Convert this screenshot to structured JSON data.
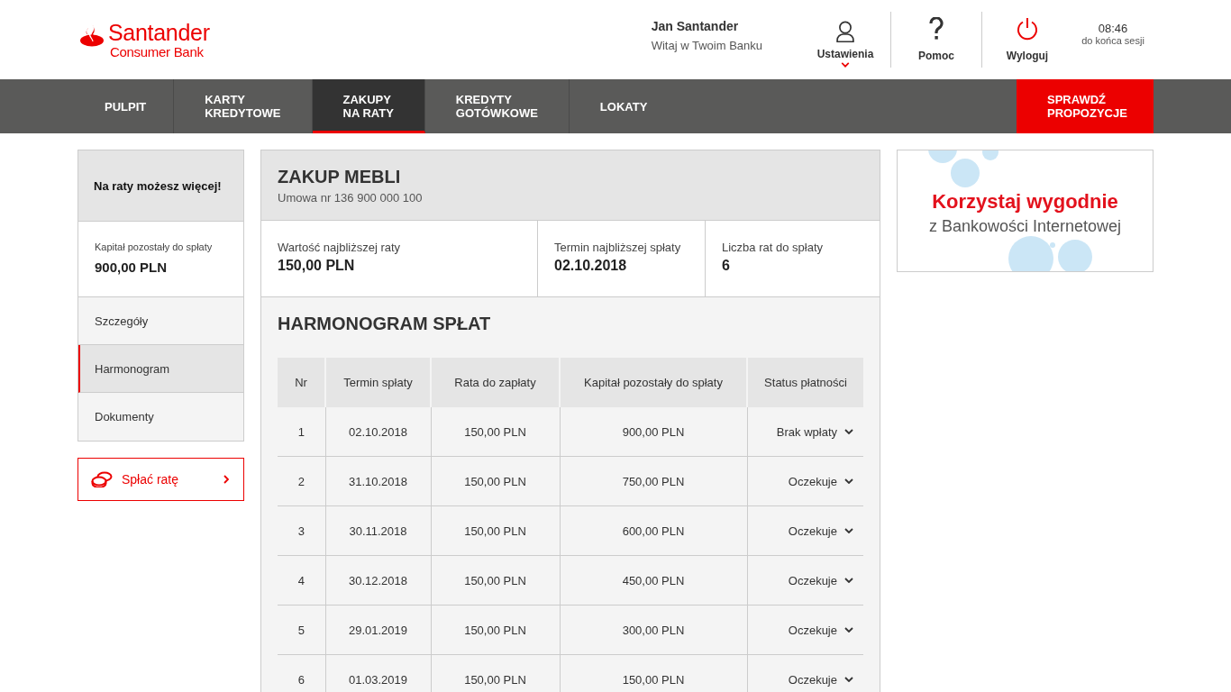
{
  "logo": {
    "brand": "Santander",
    "subtitle": "Consumer Bank"
  },
  "user": {
    "name": "Jan Santander",
    "greeting": "Witaj w Twoim Banku"
  },
  "header_actions": [
    {
      "kind": "user",
      "label": "Ustawienia",
      "expanded": false
    },
    {
      "kind": "help",
      "label": "Pomoc"
    },
    {
      "kind": "power",
      "label": "Wyloguj"
    }
  ],
  "session": {
    "time": "08:46",
    "label": "do końca sesji"
  },
  "nav": {
    "items": [
      {
        "label": "PULPIT",
        "selected": false
      },
      {
        "label": "KARTY\nKREDYTOWE",
        "selected": false
      },
      {
        "label": "ZAKUPY\nNA RATY",
        "selected": true
      },
      {
        "label": "KREDYTY\nGOTÓWKOWE",
        "selected": false
      },
      {
        "label": "LOKATY",
        "selected": false
      }
    ],
    "cta": "SPRAWDŹ\nPROPOZYCJE"
  },
  "sidebar": {
    "title": "Na raty możesz więcej!",
    "capital_label": "Kapitał pozostały do spłaty",
    "capital_value": "900,00 PLN",
    "items": [
      {
        "label": "Szczegóły",
        "selected": false
      },
      {
        "label": "Harmonogram",
        "selected": true
      },
      {
        "label": "Dokumenty",
        "selected": false
      }
    ],
    "pay_button": "Spłać ratę"
  },
  "contract": {
    "title": "ZAKUP MEBLI",
    "number": "Umowa nr 136 900 000 100",
    "stats": [
      {
        "label": "Wartość najbliższej raty",
        "value": "150,00 PLN"
      },
      {
        "label": "Termin najbliższej spłaty",
        "value": "02.10.2018"
      },
      {
        "label": "Liczba rat do spłaty",
        "value": "6"
      }
    ]
  },
  "schedule": {
    "title": "HARMONOGRAM SPŁAT",
    "columns": [
      "Nr",
      "Termin spłaty",
      "Rata do zapłaty",
      "Kapitał pozostały do spłaty",
      "Status płatności"
    ],
    "rows": [
      {
        "nr": "1",
        "date": "02.10.2018",
        "installment": "150,00 PLN",
        "capital": "900,00 PLN",
        "status": "Brak wpłaty"
      },
      {
        "nr": "2",
        "date": "31.10.2018",
        "installment": "150,00 PLN",
        "capital": "750,00 PLN",
        "status": "Oczekuje"
      },
      {
        "nr": "3",
        "date": "30.11.2018",
        "installment": "150,00 PLN",
        "capital": "600,00 PLN",
        "status": "Oczekuje"
      },
      {
        "nr": "4",
        "date": "30.12.2018",
        "installment": "150,00 PLN",
        "capital": "450,00 PLN",
        "status": "Oczekuje"
      },
      {
        "nr": "5",
        "date": "29.01.2019",
        "installment": "150,00 PLN",
        "capital": "300,00 PLN",
        "status": "Oczekuje"
      },
      {
        "nr": "6",
        "date": "01.03.2019",
        "installment": "150,00 PLN",
        "capital": "150,00 PLN",
        "status": "Oczekuje"
      }
    ]
  },
  "ad": {
    "headline": "Korzystaj wygodnie",
    "subline": "z Bankowości Internetowej"
  }
}
